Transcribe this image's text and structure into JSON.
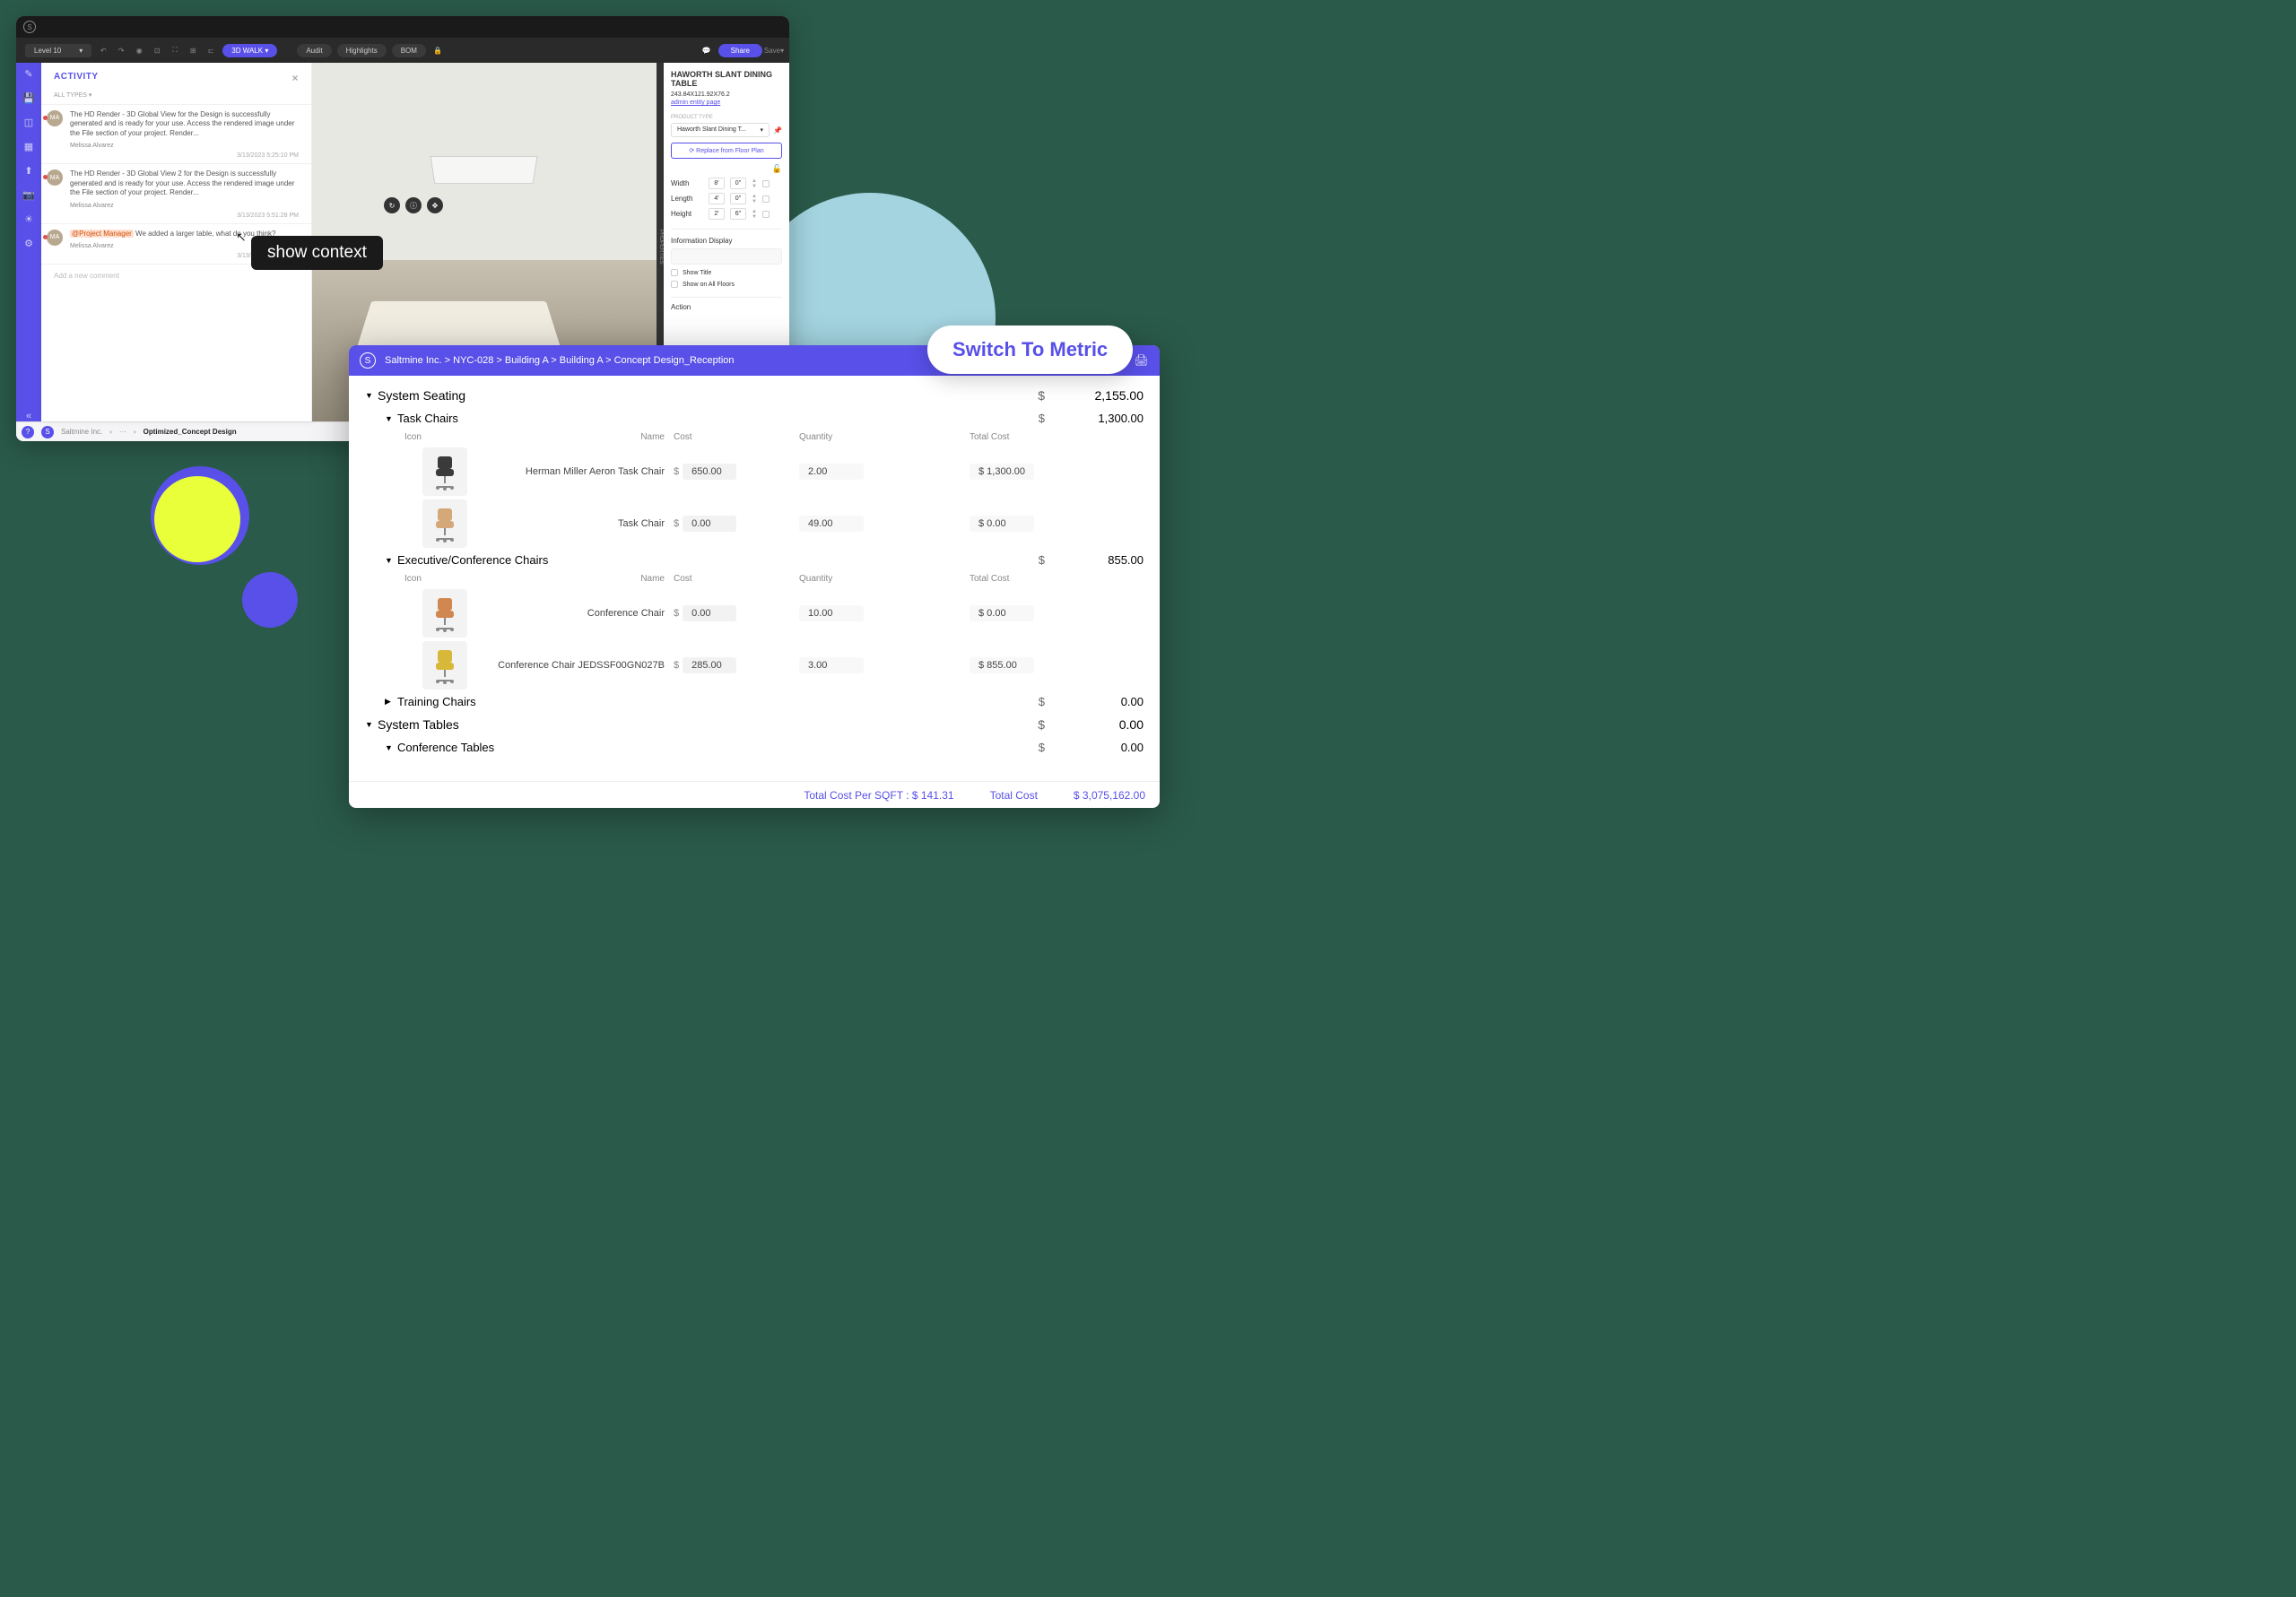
{
  "app1": {
    "toolbar": {
      "level": "Level 10",
      "walk": "3D WALK",
      "audit": "Audit",
      "highlights": "Highlights",
      "bom": "BOM",
      "share": "Share",
      "save": "Save"
    },
    "activity": {
      "title": "ACTIVITY",
      "filter": "ALL TYPES",
      "items": [
        {
          "av": "MA",
          "text": "The HD Render - 3D Global View for the Design is successfully generated and is ready for your use. Access the rendered image under the File section of your project. Render...",
          "user": "Melissa Alvarez",
          "time": "3/13/2023 5:25:10 PM"
        },
        {
          "av": "MA",
          "text": "The HD Render - 3D Global View 2 for the Design is successfully generated and is ready for your use. Access the rendered image under the File section of your project. Render...",
          "user": "Melissa Alvarez",
          "time": "3/13/2023 5:51:28 PM"
        },
        {
          "av": "MA",
          "mention": "@Project Manager",
          "text": " We added a larger table, what do you think?",
          "user": "Melissa Alvarez",
          "time": "3/13/2023 8:48:52 PM"
        }
      ],
      "add": "Add a new comment"
    },
    "properties": {
      "tab": "PROPERTIES",
      "title": "HAWORTH SLANT DINING TABLE",
      "dims": "243.84X121.92X76.2",
      "adminlink": "admin entity page",
      "producttype_lbl": "PRODUCT TYPE",
      "producttype_val": "Haworth Slant Dining T...",
      "replace": "Replace from Floor Plan",
      "width_lbl": "Width",
      "width_ft": "8'",
      "width_in": "0\"",
      "length_lbl": "Length",
      "length_ft": "4'",
      "length_in": "0\"",
      "height_lbl": "Height",
      "height_ft": "2'",
      "height_in": "6\"",
      "info_lbl": "Information Display",
      "showtitle": "Show Title",
      "showall": "Show on All Floors",
      "action_lbl": "Action"
    },
    "statusbar": {
      "org": "Saltmine Inc.",
      "design": "Optimized_Concept Design"
    }
  },
  "tooltip1": "show context",
  "app2": {
    "breadcrumb": "Saltmine Inc. > NYC-028 > Building A > Building A > Concept Design_Reception",
    "columns": {
      "icon": "Icon",
      "name": "Name",
      "cost": "Cost",
      "qty": "Quantity",
      "total": "Total Cost"
    },
    "sections": [
      {
        "name": "System Seating",
        "amount": "2,155.00",
        "expanded": true,
        "subs": [
          {
            "name": "Task Chairs",
            "amount": "1,300.00",
            "expanded": true,
            "items": [
              {
                "name": "Herman Miller Aeron Task Chair",
                "cost": "650.00",
                "qty": "2.00",
                "total": "$ 1,300.00",
                "color": "#3a3a3a"
              },
              {
                "name": "Task Chair",
                "cost": "0.00",
                "qty": "49.00",
                "total": "$ 0.00",
                "color": "#d4a878"
              }
            ]
          },
          {
            "name": "Executive/Conference Chairs",
            "amount": "855.00",
            "expanded": true,
            "items": [
              {
                "name": "Conference Chair",
                "cost": "0.00",
                "qty": "10.00",
                "total": "$ 0.00",
                "color": "#d08850"
              },
              {
                "name": "Conference Chair JEDSSF00GN027B",
                "cost": "285.00",
                "qty": "3.00",
                "total": "$ 855.00",
                "color": "#d8b838"
              }
            ]
          },
          {
            "name": "Training Chairs",
            "amount": "0.00",
            "expanded": false
          }
        ]
      },
      {
        "name": "System Tables",
        "amount": "0.00",
        "expanded": true,
        "subs": [
          {
            "name": "Conference Tables",
            "amount": "0.00",
            "expanded": true
          }
        ]
      }
    ],
    "footer": {
      "sqft": "Total Cost Per SQFT : $ 141.31",
      "total_lbl": "Total Cost",
      "total_val": "$ 3,075,162.00"
    }
  },
  "metric_pill": "Switch To Metric"
}
